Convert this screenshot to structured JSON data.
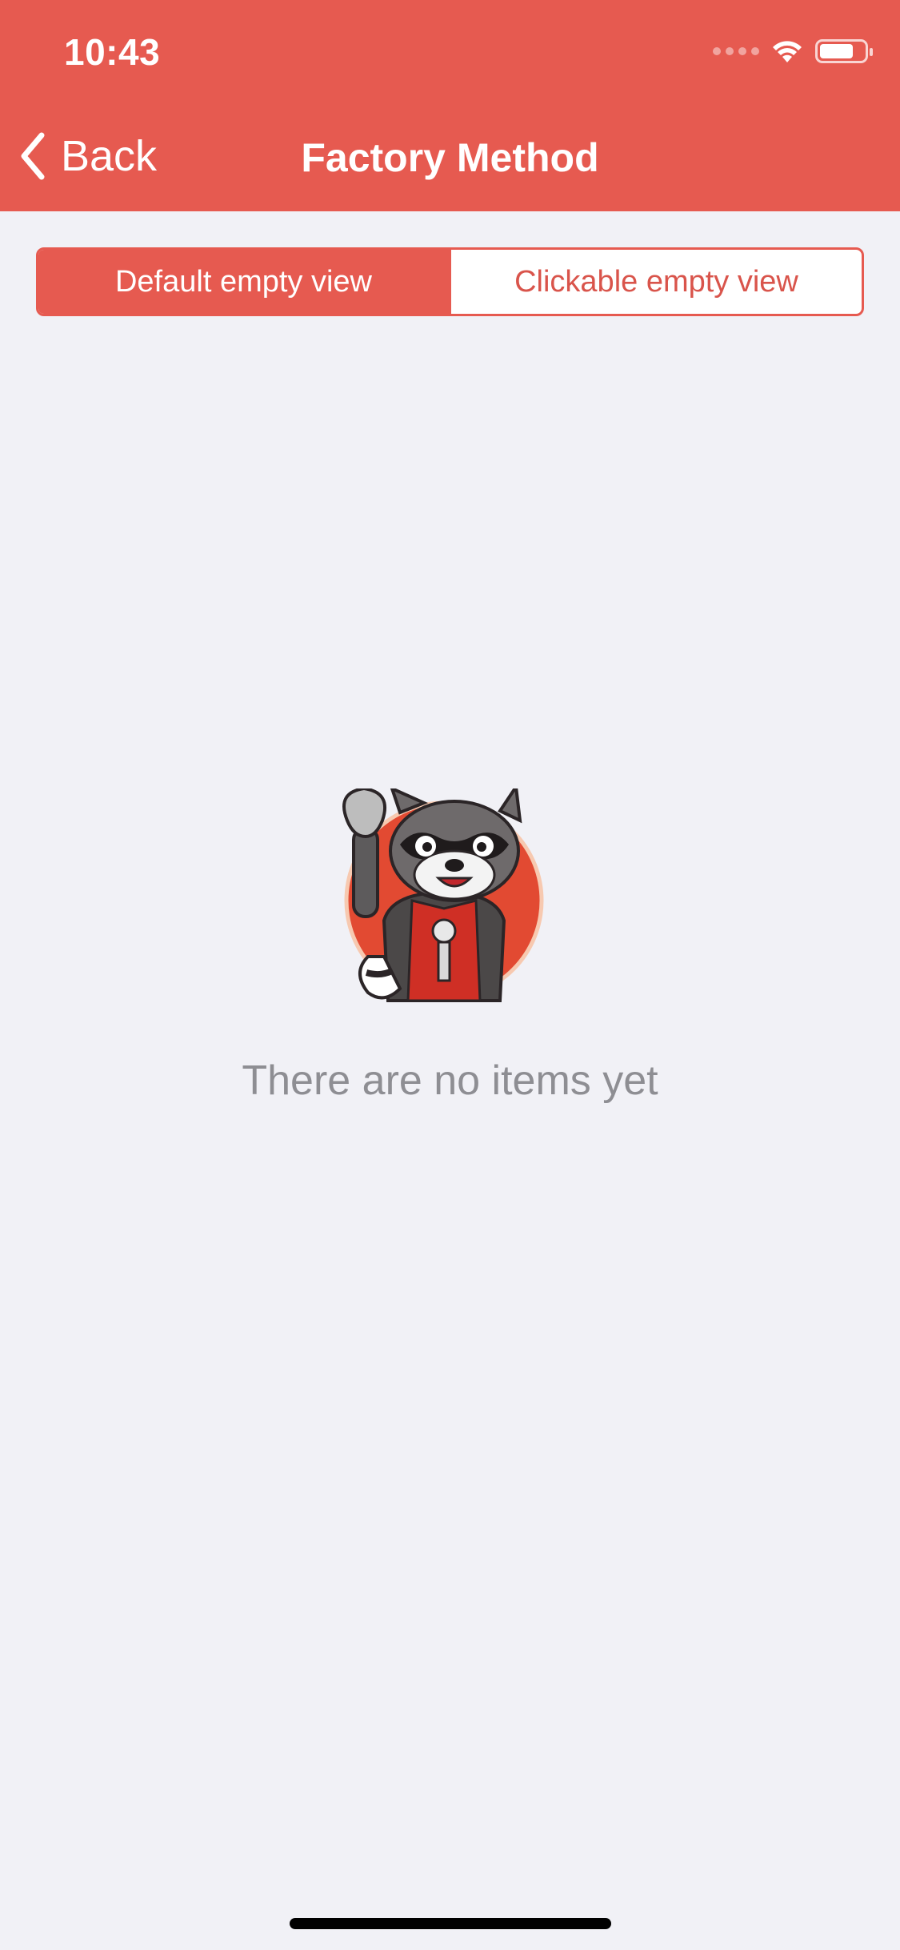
{
  "status_bar": {
    "time": "10:43",
    "battery_level_fraction": 0.75
  },
  "nav": {
    "back_label": "Back",
    "title": "Factory Method"
  },
  "segmented_control": {
    "selected_index": 0,
    "options": [
      "Default empty view",
      "Clickable empty view"
    ]
  },
  "empty_state": {
    "illustration": "raccoon-mascot",
    "message": "There are no items yet"
  },
  "colors": {
    "accent": "#e65a50",
    "background": "#f1f1f6",
    "secondary_text": "#8e8e93"
  },
  "icons": {
    "back": "chevron-left-icon",
    "wifi": "wifi-icon",
    "battery": "battery-icon",
    "signal": "cellular-signal-icon"
  }
}
